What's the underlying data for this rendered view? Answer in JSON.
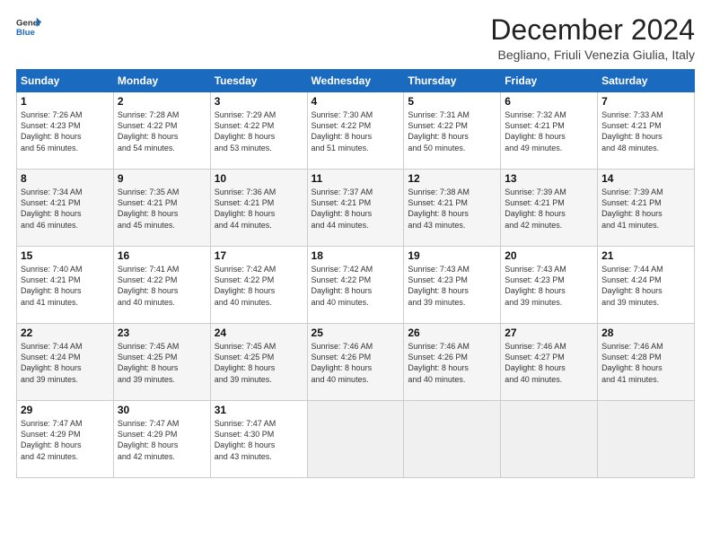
{
  "logo": {
    "line1": "General",
    "line2": "Blue"
  },
  "title": "December 2024",
  "subtitle": "Begliano, Friuli Venezia Giulia, Italy",
  "days_header": [
    "Sunday",
    "Monday",
    "Tuesday",
    "Wednesday",
    "Thursday",
    "Friday",
    "Saturday"
  ],
  "weeks": [
    [
      {
        "day": "1",
        "info": "Sunrise: 7:26 AM\nSunset: 4:23 PM\nDaylight: 8 hours\nand 56 minutes."
      },
      {
        "day": "2",
        "info": "Sunrise: 7:28 AM\nSunset: 4:22 PM\nDaylight: 8 hours\nand 54 minutes."
      },
      {
        "day": "3",
        "info": "Sunrise: 7:29 AM\nSunset: 4:22 PM\nDaylight: 8 hours\nand 53 minutes."
      },
      {
        "day": "4",
        "info": "Sunrise: 7:30 AM\nSunset: 4:22 PM\nDaylight: 8 hours\nand 51 minutes."
      },
      {
        "day": "5",
        "info": "Sunrise: 7:31 AM\nSunset: 4:22 PM\nDaylight: 8 hours\nand 50 minutes."
      },
      {
        "day": "6",
        "info": "Sunrise: 7:32 AM\nSunset: 4:21 PM\nDaylight: 8 hours\nand 49 minutes."
      },
      {
        "day": "7",
        "info": "Sunrise: 7:33 AM\nSunset: 4:21 PM\nDaylight: 8 hours\nand 48 minutes."
      }
    ],
    [
      {
        "day": "8",
        "info": "Sunrise: 7:34 AM\nSunset: 4:21 PM\nDaylight: 8 hours\nand 46 minutes."
      },
      {
        "day": "9",
        "info": "Sunrise: 7:35 AM\nSunset: 4:21 PM\nDaylight: 8 hours\nand 45 minutes."
      },
      {
        "day": "10",
        "info": "Sunrise: 7:36 AM\nSunset: 4:21 PM\nDaylight: 8 hours\nand 44 minutes."
      },
      {
        "day": "11",
        "info": "Sunrise: 7:37 AM\nSunset: 4:21 PM\nDaylight: 8 hours\nand 44 minutes."
      },
      {
        "day": "12",
        "info": "Sunrise: 7:38 AM\nSunset: 4:21 PM\nDaylight: 8 hours\nand 43 minutes."
      },
      {
        "day": "13",
        "info": "Sunrise: 7:39 AM\nSunset: 4:21 PM\nDaylight: 8 hours\nand 42 minutes."
      },
      {
        "day": "14",
        "info": "Sunrise: 7:39 AM\nSunset: 4:21 PM\nDaylight: 8 hours\nand 41 minutes."
      }
    ],
    [
      {
        "day": "15",
        "info": "Sunrise: 7:40 AM\nSunset: 4:21 PM\nDaylight: 8 hours\nand 41 minutes."
      },
      {
        "day": "16",
        "info": "Sunrise: 7:41 AM\nSunset: 4:22 PM\nDaylight: 8 hours\nand 40 minutes."
      },
      {
        "day": "17",
        "info": "Sunrise: 7:42 AM\nSunset: 4:22 PM\nDaylight: 8 hours\nand 40 minutes."
      },
      {
        "day": "18",
        "info": "Sunrise: 7:42 AM\nSunset: 4:22 PM\nDaylight: 8 hours\nand 40 minutes."
      },
      {
        "day": "19",
        "info": "Sunrise: 7:43 AM\nSunset: 4:23 PM\nDaylight: 8 hours\nand 39 minutes."
      },
      {
        "day": "20",
        "info": "Sunrise: 7:43 AM\nSunset: 4:23 PM\nDaylight: 8 hours\nand 39 minutes."
      },
      {
        "day": "21",
        "info": "Sunrise: 7:44 AM\nSunset: 4:24 PM\nDaylight: 8 hours\nand 39 minutes."
      }
    ],
    [
      {
        "day": "22",
        "info": "Sunrise: 7:44 AM\nSunset: 4:24 PM\nDaylight: 8 hours\nand 39 minutes."
      },
      {
        "day": "23",
        "info": "Sunrise: 7:45 AM\nSunset: 4:25 PM\nDaylight: 8 hours\nand 39 minutes."
      },
      {
        "day": "24",
        "info": "Sunrise: 7:45 AM\nSunset: 4:25 PM\nDaylight: 8 hours\nand 39 minutes."
      },
      {
        "day": "25",
        "info": "Sunrise: 7:46 AM\nSunset: 4:26 PM\nDaylight: 8 hours\nand 40 minutes."
      },
      {
        "day": "26",
        "info": "Sunrise: 7:46 AM\nSunset: 4:26 PM\nDaylight: 8 hours\nand 40 minutes."
      },
      {
        "day": "27",
        "info": "Sunrise: 7:46 AM\nSunset: 4:27 PM\nDaylight: 8 hours\nand 40 minutes."
      },
      {
        "day": "28",
        "info": "Sunrise: 7:46 AM\nSunset: 4:28 PM\nDaylight: 8 hours\nand 41 minutes."
      }
    ],
    [
      {
        "day": "29",
        "info": "Sunrise: 7:47 AM\nSunset: 4:29 PM\nDaylight: 8 hours\nand 42 minutes."
      },
      {
        "day": "30",
        "info": "Sunrise: 7:47 AM\nSunset: 4:29 PM\nDaylight: 8 hours\nand 42 minutes."
      },
      {
        "day": "31",
        "info": "Sunrise: 7:47 AM\nSunset: 4:30 PM\nDaylight: 8 hours\nand 43 minutes."
      },
      {
        "day": "",
        "info": ""
      },
      {
        "day": "",
        "info": ""
      },
      {
        "day": "",
        "info": ""
      },
      {
        "day": "",
        "info": ""
      }
    ]
  ]
}
